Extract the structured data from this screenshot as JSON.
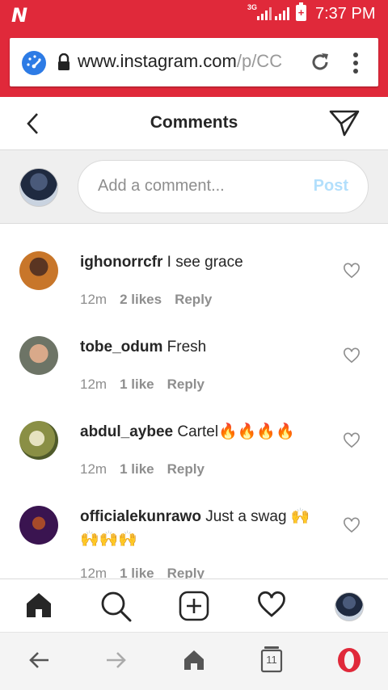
{
  "status_bar": {
    "app_logo": "N",
    "network": "3G",
    "time": "7:37 PM"
  },
  "browser": {
    "url_main": "www.instagram.com",
    "url_path": "/p/CC",
    "tab_count": "11"
  },
  "header": {
    "title": "Comments"
  },
  "composer": {
    "placeholder": "Add a comment...",
    "post_label": "Post"
  },
  "comments": [
    {
      "username": "ighonorrcfr",
      "text": "I see grace",
      "time": "12m",
      "likes": "2 likes",
      "reply": "Reply"
    },
    {
      "username": "tobe_odum",
      "text": "Fresh",
      "time": "12m",
      "likes": "1 like",
      "reply": "Reply"
    },
    {
      "username": "abdul_aybee",
      "text": "Cartel🔥🔥🔥🔥",
      "time": "12m",
      "likes": "1 like",
      "reply": "Reply"
    },
    {
      "username": "officialekunrawo",
      "text": "Just a swag 🙌🙌🙌🙌",
      "time": "12m",
      "likes": "1 like",
      "reply": "Reply"
    }
  ],
  "icons": {
    "brand_red": "#e0293a",
    "link_blue": "#b2dffc"
  }
}
